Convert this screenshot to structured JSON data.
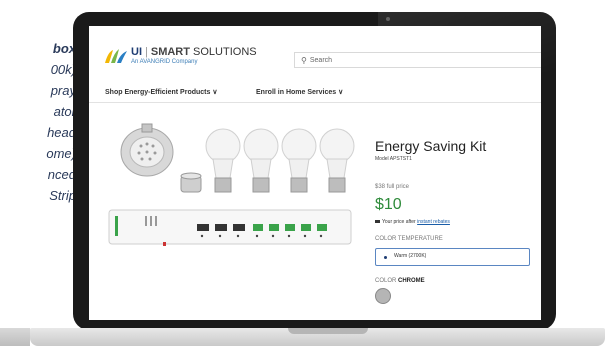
{
  "sidebar_text": {
    "lines": [
      "box",
      "00k)",
      "pray",
      "ator",
      "head",
      "ome)",
      "nced",
      "Strip"
    ]
  },
  "header": {
    "brand_ui": "UI",
    "brand_divider": "|",
    "brand_smart": "SMART",
    "brand_solutions": "SOLUTIONS",
    "brand_subtitle": "An AVANGRID Company",
    "search_placeholder": "Search"
  },
  "nav": {
    "items": [
      {
        "label": "Shop Energy-Efficient Products ∨"
      },
      {
        "label": "Enroll in Home Services ∨"
      }
    ]
  },
  "product": {
    "title": "Energy Saving Kit",
    "model": "Model APSTST1",
    "full_price": "$38 full price",
    "price": "$10",
    "after_text": "Your price after",
    "after_link": "instant rebates",
    "color_temp_label": "COLOR TEMPERATURE",
    "selected_option": "Warm (2700K)",
    "color_label": "COLOR",
    "color_value": "CHROME"
  },
  "colors": {
    "brand_blue": "#1f3d73",
    "price_green": "#2e8b3a",
    "link_blue": "#1a5da8",
    "laptop_bezel": "#1a1a1a"
  }
}
